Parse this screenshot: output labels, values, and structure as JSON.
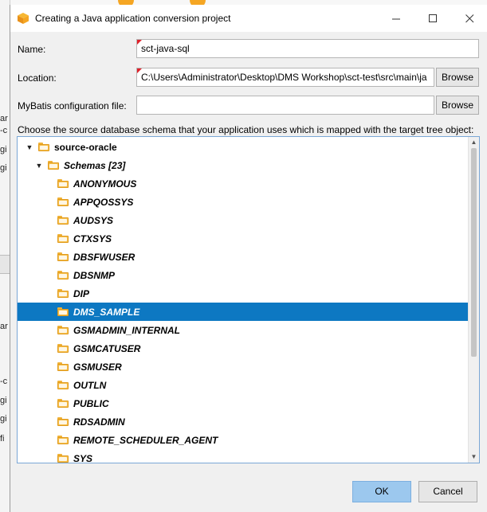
{
  "background": {
    "fragments": [
      "ar",
      "-c",
      "gi",
      "gi",
      "ar",
      "-c",
      "gi",
      "gi",
      "fi"
    ]
  },
  "titlebar": {
    "title": "Creating a Java application conversion project",
    "minimize_icon": "minimize-icon",
    "maximize_icon": "maximize-icon",
    "close_icon": "close-icon"
  },
  "form": {
    "name_label": "Name:",
    "name_value": "sct-java-sql",
    "location_label": "Location:",
    "location_value": "C:\\Users\\Administrator\\Desktop\\DMS Workshop\\sct-test\\src\\main\\ja",
    "mybatis_label": "MyBatis configuration file:",
    "mybatis_value": "",
    "browse_label": "Browse"
  },
  "tree": {
    "instruction": "Choose the source database schema that your application uses which is mapped with the target tree object:",
    "root": "source-oracle",
    "schemas_node": "Schemas [23]",
    "items": [
      "ANONYMOUS",
      "APPQOSSYS",
      "AUDSYS",
      "CTXSYS",
      "DBSFWUSER",
      "DBSNMP",
      "DIP",
      "DMS_SAMPLE",
      "GSMADMIN_INTERNAL",
      "GSMCATUSER",
      "GSMUSER",
      "OUTLN",
      "PUBLIC",
      "RDSADMIN",
      "REMOTE_SCHEDULER_AGENT",
      "SYS"
    ],
    "selected_item": "DMS_SAMPLE"
  },
  "footer": {
    "ok_label": "OK",
    "cancel_label": "Cancel"
  },
  "colors": {
    "selection": "#0d78c2",
    "folder": "#f7c04c",
    "required_marker": "#e0212b",
    "ok_button": "#9cc8ee"
  }
}
